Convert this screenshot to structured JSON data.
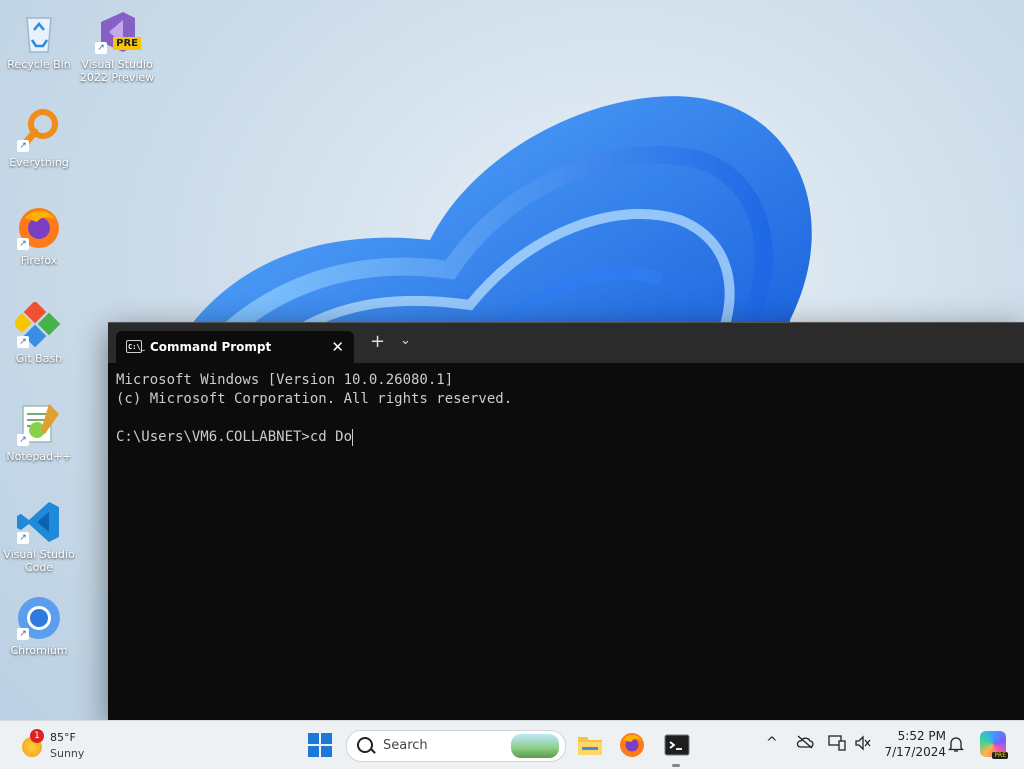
{
  "desktop": {
    "icons": [
      {
        "label": "Recycle Bin"
      },
      {
        "label": "Visual Studio 2022 Preview",
        "badge": "PRE"
      },
      {
        "label": "Everything"
      },
      {
        "label": "Firefox"
      },
      {
        "label": "Git Bash"
      },
      {
        "label": "Notepad++"
      },
      {
        "label": "Visual Studio Code"
      },
      {
        "label": "Chromium"
      }
    ]
  },
  "terminal": {
    "tab_title": "Command Prompt",
    "tab_icon_text": "C:\\_",
    "close_glyph": "✕",
    "new_tab_glyph": "+",
    "dropdown_glyph": "⌄",
    "lines": [
      "Microsoft Windows [Version 10.0.26080.1]",
      "(c) Microsoft Corporation. All rights reserved.",
      "",
      "C:\\Users\\VM6.COLLABNET>cd Do"
    ]
  },
  "taskbar": {
    "weather": {
      "temp": "85°F",
      "desc": "Sunny",
      "badge": "1"
    },
    "search": {
      "placeholder": "Search"
    },
    "tray": {
      "chevron": "^"
    },
    "clock": {
      "time": "5:52 PM",
      "date": "7/17/2024"
    },
    "copilot_badge": "PRE"
  },
  "colors": {
    "accent": "#1e78d7",
    "terminal_bg": "#0c0c0c",
    "taskbar_bg": "#eef1f4"
  }
}
